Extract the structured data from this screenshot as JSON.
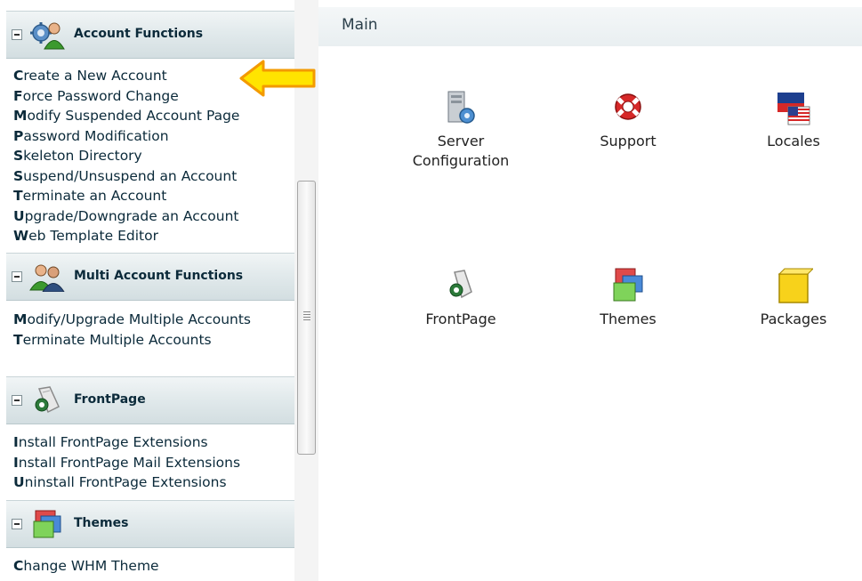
{
  "sidebar": {
    "sections": [
      {
        "title": "Account Functions",
        "icon": "account-gear-icon",
        "links": [
          {
            "first": "C",
            "rest": "reate a New Account"
          },
          {
            "first": "F",
            "rest": "orce Password Change"
          },
          {
            "first": "M",
            "rest": "odify Suspended Account Page"
          },
          {
            "first": "P",
            "rest": "assword Modification"
          },
          {
            "first": "S",
            "rest": "keleton Directory"
          },
          {
            "first": "S",
            "rest": "uspend/Unsuspend an Account"
          },
          {
            "first": "T",
            "rest": "erminate an Account"
          },
          {
            "first": "U",
            "rest": "pgrade/Downgrade an Account"
          },
          {
            "first": "W",
            "rest": "eb Template Editor"
          }
        ]
      },
      {
        "title": "Multi Account Functions",
        "icon": "users-icon",
        "links": [
          {
            "first": "M",
            "rest": "odify/Upgrade Multiple Accounts"
          },
          {
            "first": "T",
            "rest": "erminate Multiple Accounts"
          }
        ]
      },
      {
        "title": "FrontPage",
        "icon": "frontpage-icon",
        "links": [
          {
            "first": "I",
            "rest": "nstall FrontPage Extensions"
          },
          {
            "first": "I",
            "rest": "nstall FrontPage Mail Extensions"
          },
          {
            "first": "U",
            "rest": "ninstall FrontPage Extensions"
          }
        ]
      },
      {
        "title": "Themes",
        "icon": "themes-icon",
        "links": [
          {
            "first": "C",
            "rest": "hange WHM Theme"
          }
        ]
      }
    ]
  },
  "main": {
    "title": "Main",
    "tiles": [
      {
        "label": "Server Configuration",
        "icon": "server-config-icon"
      },
      {
        "label": "Support",
        "icon": "lifebuoy-icon"
      },
      {
        "label": "Locales",
        "icon": "flag-icon"
      },
      {
        "label": "FrontPage",
        "icon": "frontpage-icon"
      },
      {
        "label": "Themes",
        "icon": "themes-icon"
      },
      {
        "label": "Packages",
        "icon": "package-icon"
      }
    ]
  },
  "colors": {
    "link_text": "#0b2a3a",
    "arrow_fill": "#ffe400",
    "arrow_stroke": "#f39a00"
  }
}
